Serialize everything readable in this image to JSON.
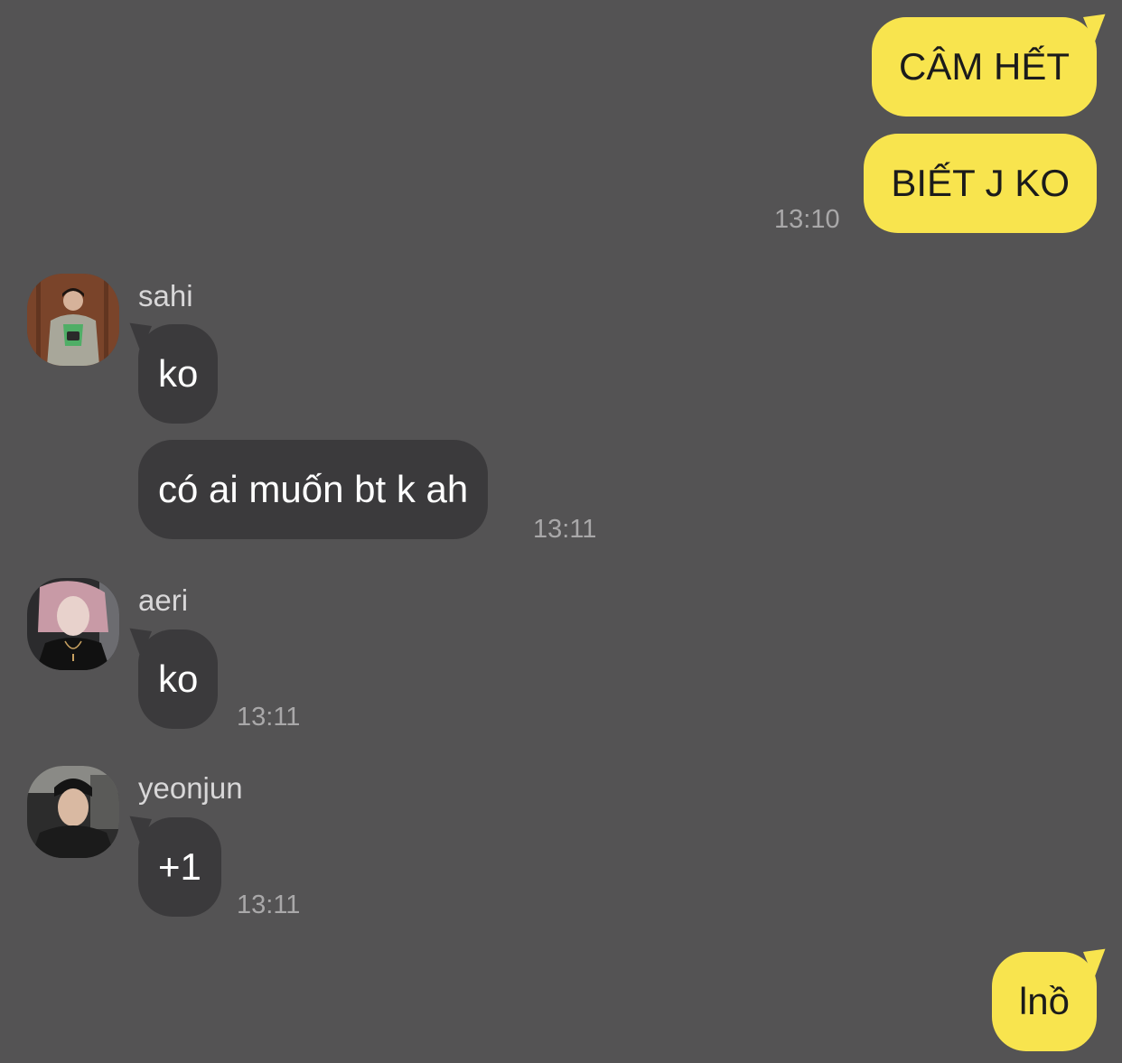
{
  "messages": {
    "m1": {
      "text": "CÂM HẾT"
    },
    "m2": {
      "text": "BIẾT J KO",
      "time": "13:10"
    },
    "sahi": {
      "name": "sahi",
      "m1": "ko",
      "m2": "có ai muốn bt k ah",
      "time": "13:11"
    },
    "aeri": {
      "name": "aeri",
      "m1": "ko",
      "time": "13:11"
    },
    "yeonjun": {
      "name": "yeonjun",
      "m1": "+1",
      "time": "13:11"
    },
    "m3": {
      "text": "lnồ"
    }
  },
  "colors": {
    "background": "#545354",
    "outgoing_bubble": "#f8e44e",
    "incoming_bubble": "#3b3a3c",
    "timestamp": "#a9a8a9"
  }
}
